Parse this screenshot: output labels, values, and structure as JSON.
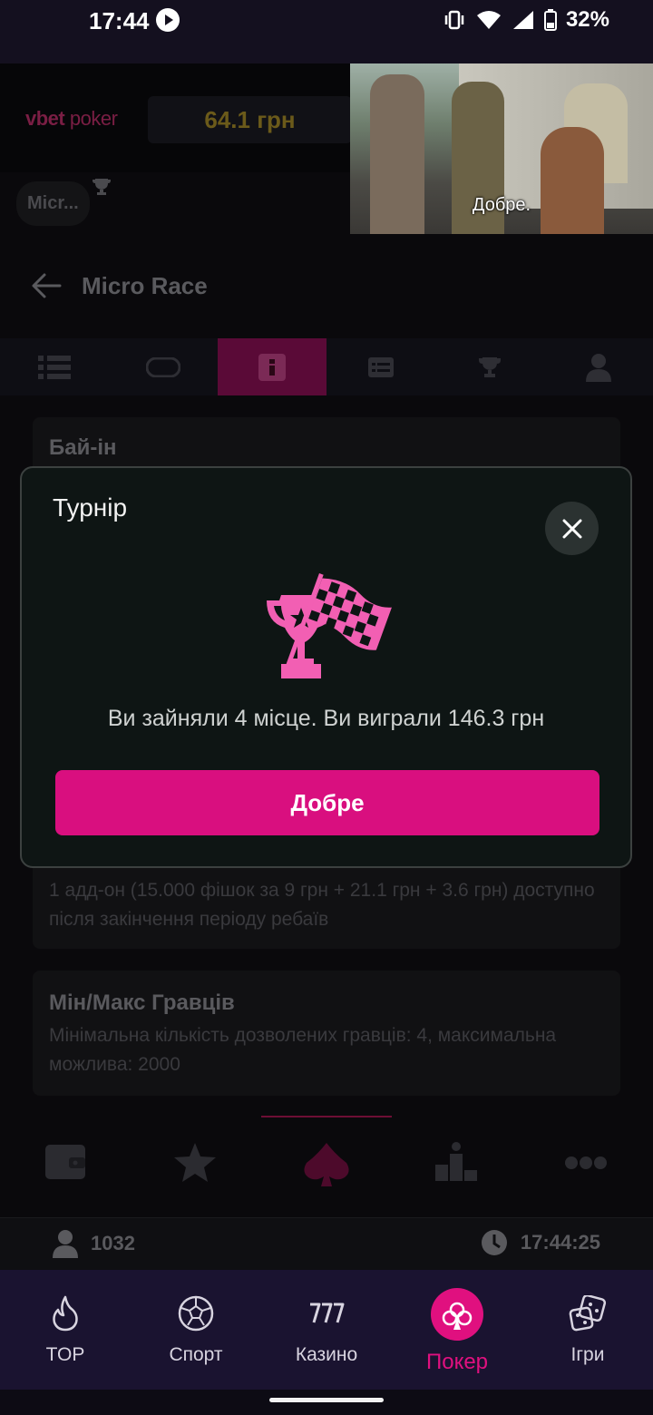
{
  "status_bar": {
    "time": "17:44",
    "battery": "32%"
  },
  "header": {
    "logo_brand": "vbet",
    "logo_product": "poker",
    "balance": "64.1 грн",
    "tournament_chip": "Micr..."
  },
  "video": {
    "subtitle": "Добре."
  },
  "page": {
    "title": "Micro Race"
  },
  "tabs": [
    "list",
    "table",
    "info",
    "details",
    "prizes",
    "players"
  ],
  "cards": {
    "buyin_title": "Бай-ін",
    "addon_text": "1 адд-он (15.000 фішок за 9 грн + 21.1 грн + 3.6 грн) доступно після закінчення періоду ребаїв",
    "minmax_title": "Мін/Макс Гравців",
    "minmax_text": "Мінімальна кількість дозволених гравців: 4, максимальна можлива: 2000"
  },
  "info_bar": {
    "players_count": "1032",
    "clock": "17:44:25"
  },
  "modal": {
    "title": "Турнір",
    "message": "Ви зайняли 4 місце. Ви виграли 146.3 грн",
    "ok_button": "Добре",
    "accent_color": "#f25fb3"
  },
  "bottom_nav": {
    "items": [
      {
        "label": "TOP",
        "icon": "flame-icon"
      },
      {
        "label": "Спорт",
        "icon": "soccer-ball-icon"
      },
      {
        "label": "Казино",
        "icon": "slot-777-icon"
      },
      {
        "label": "Покер",
        "icon": "club-icon",
        "active": true
      },
      {
        "label": "Ігри",
        "icon": "dice-icon"
      }
    ],
    "active_color": "#e0107f"
  }
}
